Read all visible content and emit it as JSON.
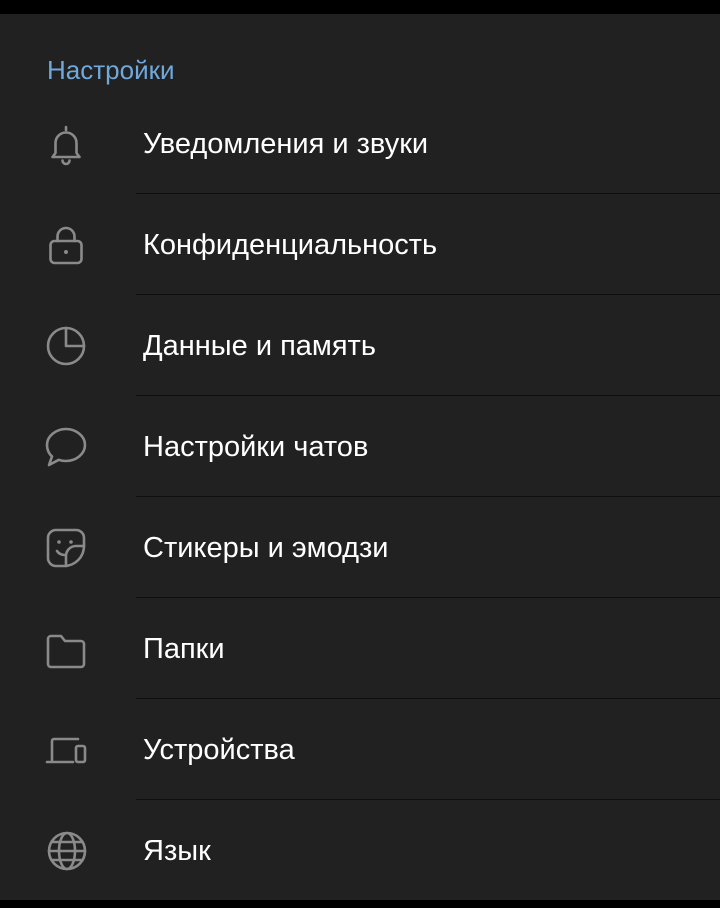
{
  "settings": {
    "title": "Настройки",
    "items": [
      {
        "label": "Уведомления и звуки",
        "icon": "bell-icon"
      },
      {
        "label": "Конфиденциальность",
        "icon": "lock-icon"
      },
      {
        "label": "Данные и память",
        "icon": "pie-chart-icon"
      },
      {
        "label": "Настройки чатов",
        "icon": "chat-bubble-icon"
      },
      {
        "label": "Стикеры и эмодзи",
        "icon": "sticker-icon"
      },
      {
        "label": "Папки",
        "icon": "folder-icon"
      },
      {
        "label": "Устройства",
        "icon": "devices-icon"
      },
      {
        "label": "Язык",
        "icon": "globe-icon"
      }
    ]
  },
  "colors": {
    "background": "#212121",
    "accent": "#71a8dc",
    "icon": "#8a8a8a",
    "text": "#ffffff"
  }
}
